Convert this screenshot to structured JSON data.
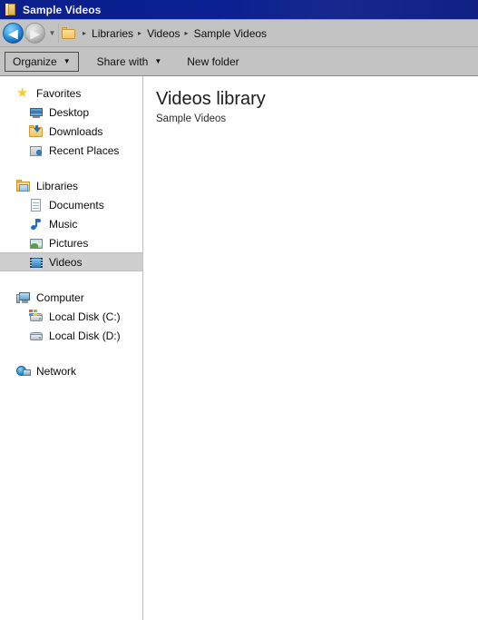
{
  "window": {
    "title": "Sample Videos",
    "title_icon": "folder-icon"
  },
  "navigation": {
    "back_button": "◀",
    "back_icon": "back-arrow-icon",
    "forward_button": "▶",
    "forward_icon": "forward-arrow-icon",
    "history_chevron": "▼",
    "address_icon": "folder-icon",
    "breadcrumbs": [
      {
        "label": "Libraries",
        "separator": "▸"
      },
      {
        "label": "Videos",
        "separator": "▸"
      },
      {
        "label": "Sample Videos",
        "separator": "▸"
      }
    ],
    "leading_separator": "▸"
  },
  "toolbar": {
    "organize_label": "Organize",
    "organize_caret": "▼",
    "share_with_label": "Share with",
    "share_with_caret": "▼",
    "new_folder_label": "New folder"
  },
  "sidebar": {
    "groups": [
      {
        "name": "favorites",
        "root": {
          "label": "Favorites",
          "icon": "star-icon"
        },
        "items": [
          {
            "label": "Desktop",
            "icon": "desktop-monitor-icon"
          },
          {
            "label": "Downloads",
            "icon": "downloads-folder-icon"
          },
          {
            "label": "Recent Places",
            "icon": "recent-places-icon"
          }
        ]
      },
      {
        "name": "libraries",
        "root": {
          "label": "Libraries",
          "icon": "libraries-icon"
        },
        "items": [
          {
            "label": "Documents",
            "icon": "document-icon"
          },
          {
            "label": "Music",
            "icon": "music-note-icon"
          },
          {
            "label": "Pictures",
            "icon": "pictures-icon"
          },
          {
            "label": "Videos",
            "icon": "videos-film-icon",
            "selected": true
          }
        ]
      },
      {
        "name": "computer",
        "root": {
          "label": "Computer",
          "icon": "computer-icon"
        },
        "items": [
          {
            "label": "Local Disk (C:)",
            "icon": "system-disk-icon"
          },
          {
            "label": "Local Disk (D:)",
            "icon": "hard-disk-icon"
          }
        ]
      },
      {
        "name": "network",
        "root": {
          "label": "Network",
          "icon": "network-icon"
        },
        "items": []
      }
    ]
  },
  "content": {
    "library_title": "Videos library",
    "library_subtitle": "Sample Videos"
  },
  "colors": {
    "titlebar_blue": "#0b1f8c",
    "chrome_gray": "#c3c3c3",
    "selection_gray": "#cfcfcf",
    "content_white": "#ffffff",
    "folder_yellow": "#f3c464"
  }
}
